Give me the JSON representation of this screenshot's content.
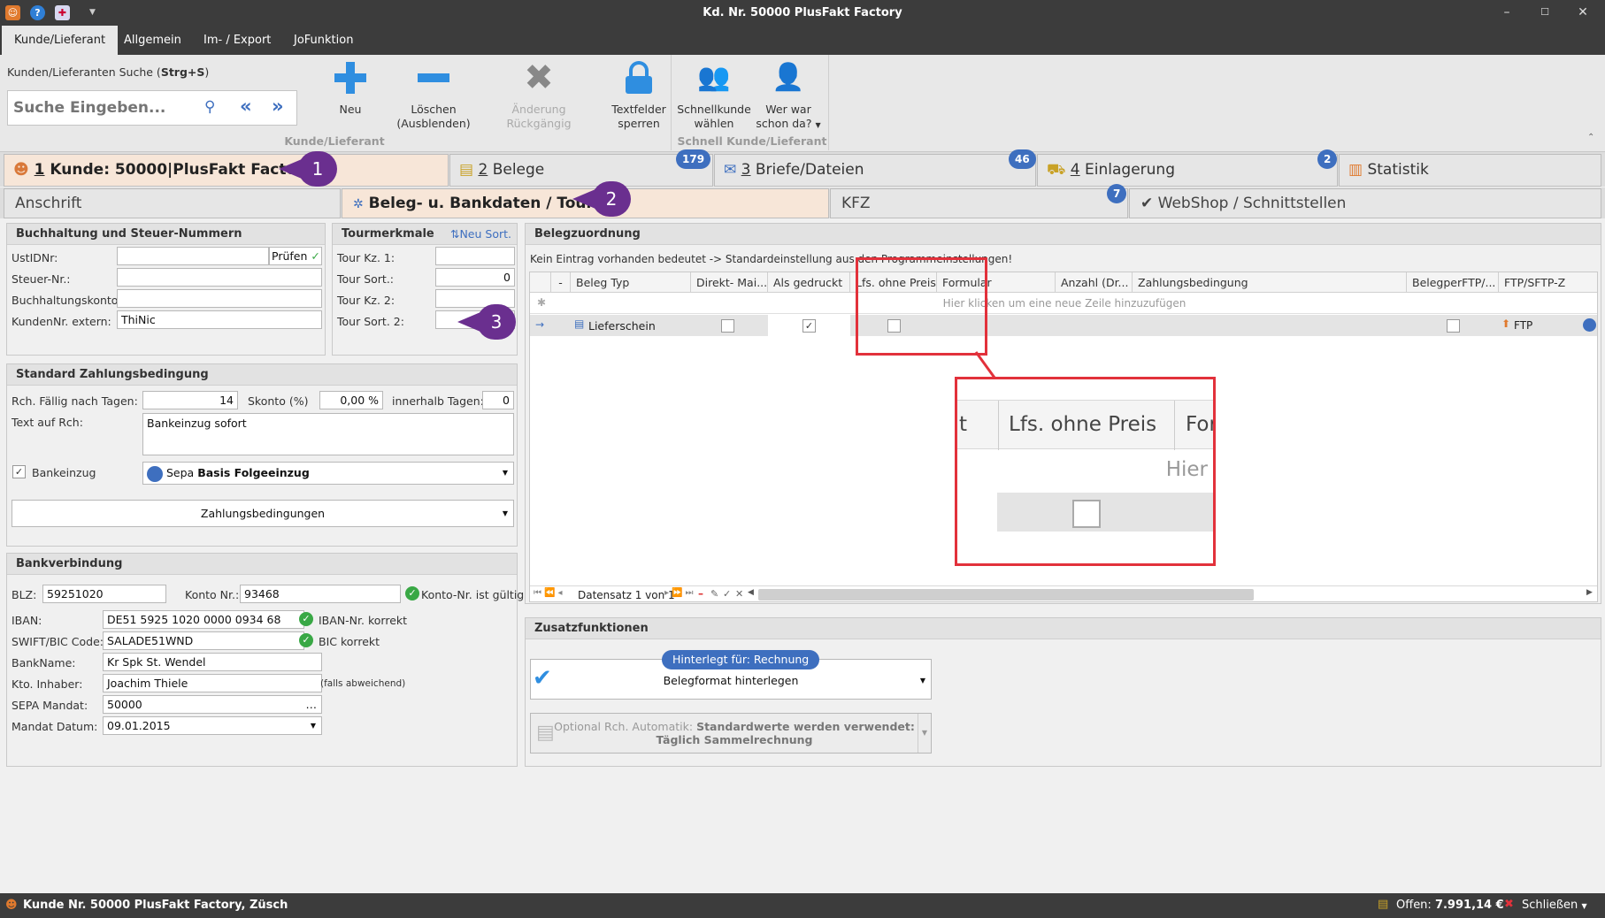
{
  "window": {
    "title": "Kd. Nr. 50000 PlusFakt Factory"
  },
  "menu": {
    "tabs": [
      "Kunde/Lieferant",
      "Allgemein",
      "Im- / Export",
      "JoFunktion"
    ]
  },
  "ribbon": {
    "search_label_prefix": "Kunden/Lieferanten Suche (",
    "search_label_shortcut": "Strg+S",
    "search_label_suffix": ")",
    "search_placeholder": "Suche Eingeben...",
    "buttons": {
      "neu": "Neu",
      "loeschen1": "Löschen",
      "loeschen2": "(Ausblenden)",
      "aenderung": "Änderung Rückgängig",
      "textfelder1": "Textfelder",
      "textfelder2": "sperren",
      "schnellkunde1": "Schnellkunde",
      "schnellkunde2": "wählen",
      "werwar1": "Wer war",
      "werwar2": "schon da?"
    },
    "group1": "Kunde/Lieferant",
    "group2": "Schnell Kunde/Lieferant"
  },
  "tabs1": {
    "kunde": {
      "num": "1",
      "label": " Kunde: 50000|PlusFakt Factory"
    },
    "belege": {
      "num": "2",
      "label": " Belege",
      "badge": "179"
    },
    "briefe": {
      "num": "3",
      "label": " Briefe/Dateien",
      "badge": "46"
    },
    "einlagerung": {
      "num": "4",
      "label": " Einlagerung",
      "badge": "2"
    },
    "statistik": {
      "label": "Statistik"
    }
  },
  "tabs2": {
    "anschrift": "Anschrift",
    "beleg": "Beleg- u. Bankdaten / Tour",
    "kfz": "KFZ",
    "webshop": "WebShop / Schnittstellen",
    "webshop_badge": "7"
  },
  "callouts": [
    "1",
    "2",
    "3"
  ],
  "buchhaltung": {
    "title": "Buchhaltung und Steuer-Nummern",
    "ustid_label": "UstIDNr:",
    "pruefen": "Prüfen",
    "steuer_label": "Steuer-Nr.:",
    "konto_label": "Buchhaltungskonto:",
    "kunden_label": "KundenNr. extern:",
    "kunden_value": "ThiNic"
  },
  "tour": {
    "title": "Tourmerkmale",
    "neu_sort": "Neu Sort.",
    "kz1": "Tour Kz. 1:",
    "sort1": "Tour Sort.:",
    "sort1_value": "0",
    "kz2": "Tour Kz. 2:",
    "sort2": "Tour Sort. 2:"
  },
  "zahlung": {
    "title": "Standard Zahlungsbedingung",
    "faellig_label": "Rch. Fällig nach Tagen:",
    "faellig_value": "14",
    "skonto_label": "Skonto (%)",
    "skonto_value": "0,00 %",
    "innerhalb_label": "innerhalb Tagen:",
    "innerhalb_value": "0",
    "text_label": "Text auf Rch:",
    "text_value": "Bankeinzug sofort",
    "bankeinzug": "Bankeinzug",
    "sepa_prefix": "Sepa ",
    "sepa_bold": "Basis Folgeeinzug",
    "zahlungsbedingungen": "Zahlungsbedingungen"
  },
  "bank": {
    "title": "Bankverbindung",
    "blz_label": "BLZ:",
    "blz_value": "59251020",
    "konto_label": "Konto Nr.:",
    "konto_value": "93468",
    "konto_ok": "Konto-Nr. ist gültig",
    "iban_label": "IBAN:",
    "iban_value": "DE51 5925 1020 0000 0934 68",
    "iban_ok": "IBAN-Nr. korrekt",
    "bic_label": "SWIFT/BIC Code:",
    "bic_value": "SALADE51WND",
    "bic_ok": "BIC korrekt",
    "bankname_label": "BankName:",
    "bankname_value": "Kr Spk St. Wendel",
    "inhaber_label": "Kto. Inhaber:",
    "inhaber_value": "Joachim Thiele",
    "inhaber_note": "(falls abweichend)",
    "mandat_label": "SEPA Mandat:",
    "mandat_value": "50000",
    "datum_label": "Mandat Datum:",
    "datum_value": "09.01.2015"
  },
  "belegzuordnung": {
    "title": "Belegzuordnung",
    "info": "Kein Eintrag vorhanden bedeutet -> Standardeinstellung aus den Programmeinstellungen!",
    "columns": [
      "-",
      "Beleg Typ",
      "Direkt- Mai...",
      "Als gedruckt",
      "Lfs. ohne Preis",
      "Formular",
      "Anzahl (Dr...",
      "Zahlungsbedingung",
      "BelegperFTP/...",
      "FTP/SFTP-Z"
    ],
    "new_row": "Hier klicken um eine neue Zeile hinzuzufügen",
    "row": {
      "beleg_typ": "Lieferschein",
      "ftp": "FTP"
    },
    "nav": "Datensatz 1 von 1"
  },
  "zoom": {
    "col_t": "t",
    "col_lfs": "Lfs. ohne Preis",
    "col_fo": "For",
    "hier": "Hier"
  },
  "zusatz": {
    "title": "Zusatzfunktionen",
    "hinterlegt": "Hinterlegt für: Rechnung",
    "belegformat": "Belegformat hinterlegen",
    "optional_prefix": "Optional Rch. Automatik: ",
    "optional_bold": "Standardwerte werden verwendet:",
    "optional_line2": "Täglich Sammelrechnung"
  },
  "status": {
    "left": "Kunde Nr. 50000 PlusFakt Factory, Züsch",
    "offen_label": "Offen: ",
    "offen_value": "7.991,14 €",
    "schliessen": "Schließen"
  },
  "colors": {
    "accent": "#3e6fbf",
    "callout": "#6a2f8f",
    "active_tab": "#f7e6d8",
    "zoom_border": "#e2313b",
    "ok": "#39a845"
  }
}
